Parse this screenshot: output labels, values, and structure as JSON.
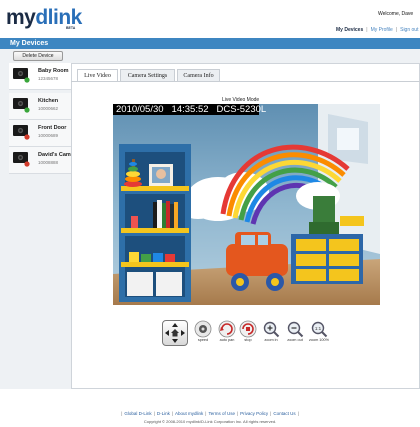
{
  "header": {
    "logo_left": "my",
    "logo_right": "dlink",
    "logo_beta": "BETA",
    "welcome": "Welcome, Dave",
    "nav": [
      {
        "label": "My Devices",
        "current": true
      },
      {
        "label": "My Profile",
        "current": false
      },
      {
        "label": "Sign out",
        "current": false
      }
    ]
  },
  "devices_bar": {
    "title": "My Devices",
    "delete_label": "Delete Device"
  },
  "devices": [
    {
      "name": "Baby Room",
      "id": "12345678",
      "selected": true,
      "status": "green"
    },
    {
      "name": "Kitchen",
      "id": "10000662",
      "selected": false,
      "status": "green"
    },
    {
      "name": "Front Door",
      "id": "10000689",
      "selected": false,
      "status": "red"
    },
    {
      "name": "David's Cam",
      "id": "10008888",
      "selected": false,
      "status": "red"
    }
  ],
  "tabs": [
    {
      "label": "Live Video",
      "active": true
    },
    {
      "label": "Camera Settings",
      "active": false
    },
    {
      "label": "Camera Info",
      "active": false
    }
  ],
  "video": {
    "mode_label": "Live Video Mode",
    "osd_date": "2010/05/30",
    "osd_time": "14:35:52",
    "osd_model": "DCS-5230L"
  },
  "controls": [
    {
      "label": "speed",
      "icon": "speed-icon"
    },
    {
      "label": "auto pan",
      "icon": "auto-pan-icon"
    },
    {
      "label": "stop",
      "icon": "stop-icon"
    },
    {
      "label": "zoom in",
      "icon": "zoom-in-icon"
    },
    {
      "label": "zoom out",
      "icon": "zoom-out-icon"
    },
    {
      "label": "zoom 100%",
      "icon": "zoom-100-icon"
    }
  ],
  "footer": {
    "links": [
      "Global D-Link",
      "D-Link",
      "About mydlink",
      "Terms of Use",
      "Privacy Policy",
      "Contact Us"
    ],
    "copyright": "Copyright © 2008-2010 mydlink/D-Link Corporation Inc. All rights reserved."
  },
  "colors": {
    "accent": "#3d86c1",
    "status_green": "#3aa63a",
    "status_red": "#d23b2b",
    "logo_dark": "#1b2b44"
  }
}
